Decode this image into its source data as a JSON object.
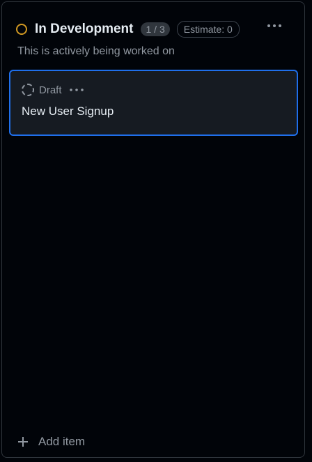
{
  "column": {
    "title": "In Development",
    "count": "1 / 3",
    "estimate": "Estimate: 0",
    "description": "This is actively being worked on",
    "status_color": "#d29922",
    "menu_icon": "kebab-horizontal-icon"
  },
  "cards": [
    {
      "status_label": "Draft",
      "status_icon": "draft-issue-icon",
      "title": "New User Signup",
      "selected": true,
      "menu_icon": "kebab-horizontal-icon"
    }
  ],
  "footer": {
    "add_label": "Add item",
    "add_icon": "plus-icon"
  },
  "colors": {
    "background": "#010409",
    "card_background": "#161b22",
    "selection_border": "#1f6feb",
    "text_primary": "#e6edf3",
    "text_muted": "#9198a1"
  }
}
